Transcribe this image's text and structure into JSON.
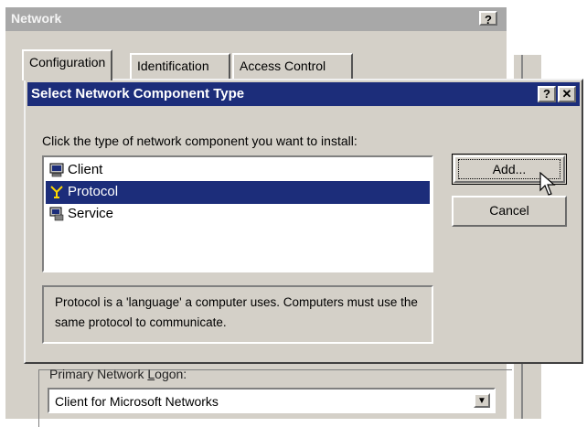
{
  "network_window": {
    "title": "Network",
    "help_button": "?",
    "tabs": [
      {
        "label": "Configuration",
        "active": true
      },
      {
        "label": "Identification",
        "active": false
      },
      {
        "label": "Access Control",
        "active": false
      }
    ],
    "primary_logon": {
      "label_pre": "Primary Network ",
      "label_accel": "L",
      "label_post": "ogon:",
      "value": "Client for Microsoft Networks"
    }
  },
  "dialog": {
    "title": "Select Network Component Type",
    "help_button": "?",
    "close_button": "✕",
    "instruction": "Click the type of network component you want to install:",
    "components": [
      {
        "label": "Client",
        "icon": "client-icon",
        "selected": false
      },
      {
        "label": "Protocol",
        "icon": "protocol-icon",
        "selected": true
      },
      {
        "label": "Service",
        "icon": "service-icon",
        "selected": false
      }
    ],
    "add_button": "Add...",
    "cancel_button": "Cancel",
    "description": "Protocol is a 'language' a computer uses. Computers must use the same protocol to communicate."
  },
  "colors": {
    "titlebar_active": "#1c2d7a",
    "titlebar_inactive": "#a8a8a8",
    "face": "#d4d0c8",
    "selection": "#1c2d7a"
  }
}
